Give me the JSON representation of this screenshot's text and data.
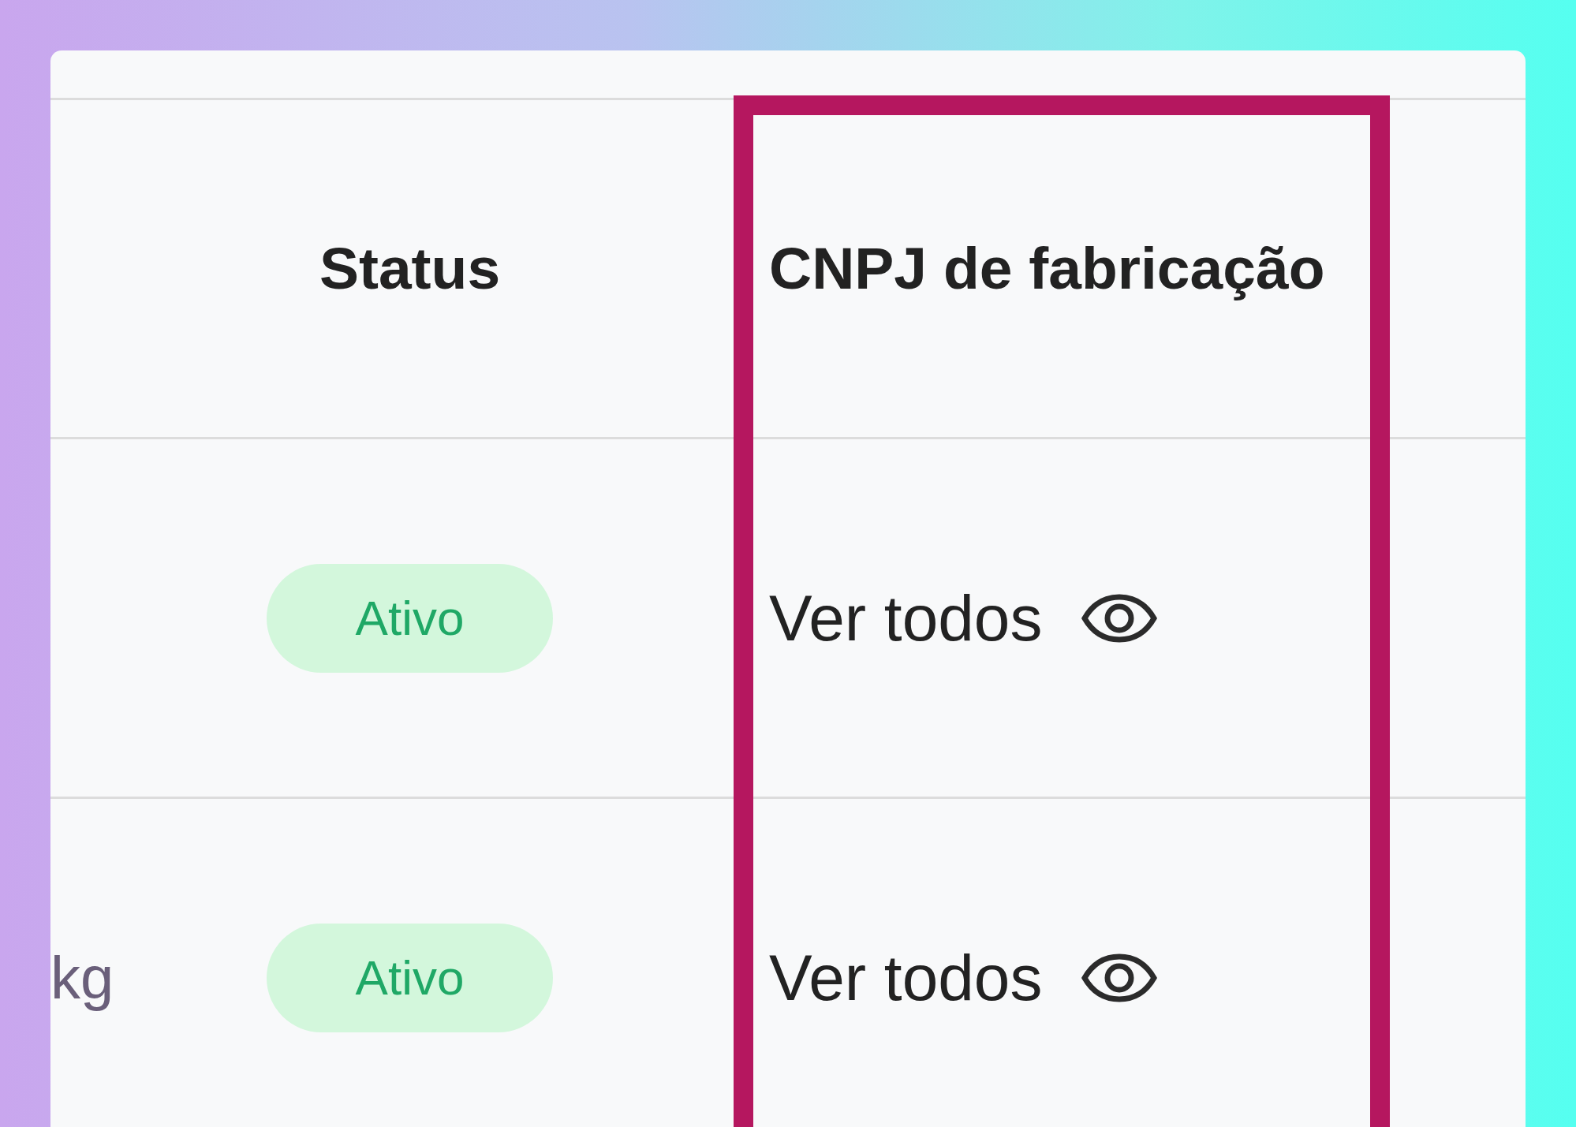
{
  "table": {
    "columns": [
      {
        "label": "Status",
        "highlighted": false
      },
      {
        "label": "CNPJ de fabricação",
        "highlighted": true
      }
    ],
    "rows": [
      {
        "status": "Ativo",
        "cnpj_link": "Ver todos"
      },
      {
        "column_1": "kg",
        "status": "Ativo",
        "cnpj_link": "Ver todos"
      }
    ]
  }
}
